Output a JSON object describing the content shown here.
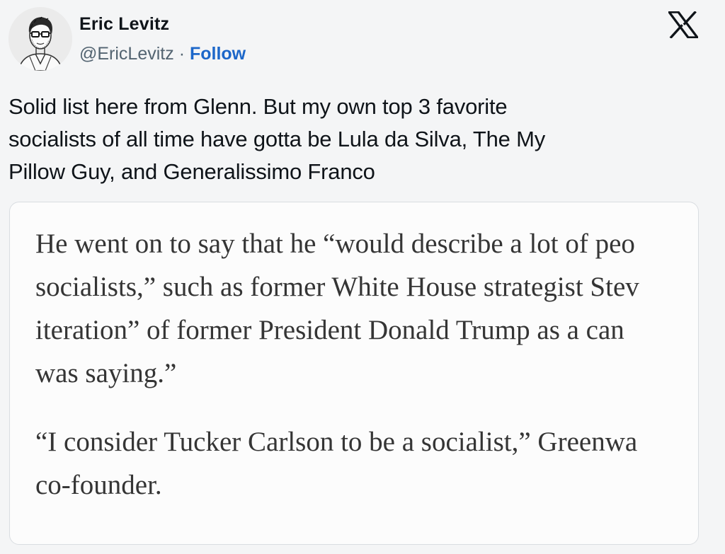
{
  "author": {
    "name": "Eric Levitz",
    "handle": "@EricLevitz",
    "separator": " · ",
    "follow_label": "Follow"
  },
  "tweet": {
    "text_lines": [
      "Solid list here from Glenn. But my own top 3 favorite",
      "socialists of all time have gotta be Lula da Silva, The My",
      "Pillow Guy, and Generalissimo Franco"
    ]
  },
  "quote": {
    "paragraphs": [
      {
        "lines": [
          "He went on to say that he “would describe a lot of peo",
          "socialists,” such as former White House strategist Stev",
          "iteration” of former President Donald Trump as a can",
          "was saying.”"
        ]
      },
      {
        "lines": [
          "“I consider Tucker Carlson to be a socialist,” Greenwa",
          "co-founder."
        ]
      }
    ]
  },
  "icons": {
    "avatar": "avatar-portrait",
    "platform_logo": "x-logo-icon"
  },
  "colors": {
    "follow": "#1d67c9",
    "handle": "#536471",
    "quote_text": "#353535"
  }
}
